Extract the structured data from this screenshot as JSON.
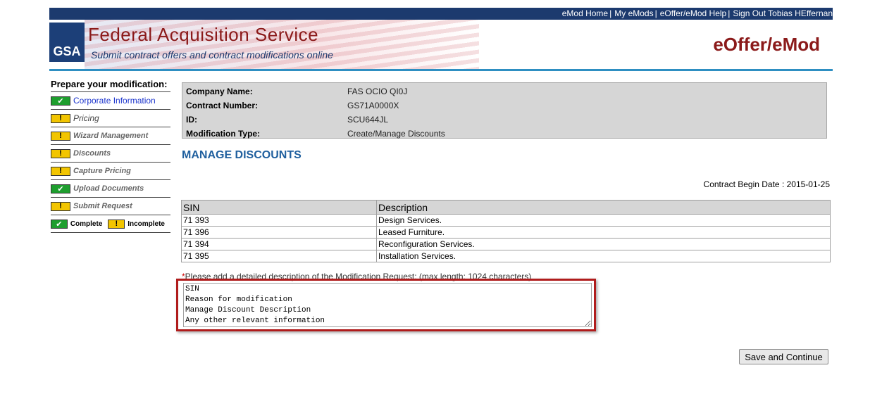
{
  "topnav": {
    "emod_home": "eMod Home",
    "my_emods": "My eMods",
    "help": "eOffer/eMod Help",
    "signout": "Sign Out Tobias HEffernan"
  },
  "banner": {
    "logo": "GSA",
    "title": "Federal Acquisition Service",
    "subtitle": "Submit contract offers and contract modifications online",
    "app_title": "eOffer/eMod"
  },
  "sidebar": {
    "heading": "Prepare your modification:",
    "items": [
      {
        "label": "Corporate Information",
        "status": "complete"
      },
      {
        "label": "Pricing",
        "status": "incomplete"
      },
      {
        "label": "Wizard Management",
        "status": "incomplete"
      },
      {
        "label": "Discounts",
        "status": "incomplete"
      },
      {
        "label": "Capture Pricing",
        "status": "incomplete"
      },
      {
        "label": "Upload Documents",
        "status": "complete"
      },
      {
        "label": "Submit Request",
        "status": "incomplete"
      }
    ],
    "legend": {
      "complete": "Complete",
      "incomplete": "Incomplete"
    }
  },
  "info": {
    "company_name_label": "Company Name:",
    "company_name": "FAS OCIO QI0J",
    "contract_number_label": "Contract Number:",
    "contract_number": "GS71A0000X",
    "id_label": "ID:",
    "id": "SCU644JL",
    "mod_type_label": "Modification Type:",
    "mod_type": "Create/Manage Discounts"
  },
  "section": {
    "title": "MANAGE DISCOUNTS",
    "begin_date": "Contract Begin Date : 2015-01-25"
  },
  "sin_table": {
    "headers": [
      "SIN",
      "Description"
    ],
    "rows": [
      {
        "sin": "71 393",
        "description": "Design Services."
      },
      {
        "sin": "71 396",
        "description": "Leased Furniture."
      },
      {
        "sin": "71 394",
        "description": "Reconfiguration Services."
      },
      {
        "sin": "71 395",
        "description": "Installation Services."
      }
    ]
  },
  "request": {
    "label": "Please add a detailed description of the Modification Request: (max length: 1024 characters)",
    "text": "SIN\nReason for modification\nManage Discount Description\nAny other relevant information"
  },
  "save_button": "Save and Continue",
  "colors": {
    "nav_bg": "#1c3a6e",
    "brand_red": "#8b1a1a",
    "section_blue": "#1f5f9e",
    "complete_green": "#1e9e2e",
    "incomplete_yellow": "#f2c500",
    "highlight_red": "#b01c1c"
  }
}
